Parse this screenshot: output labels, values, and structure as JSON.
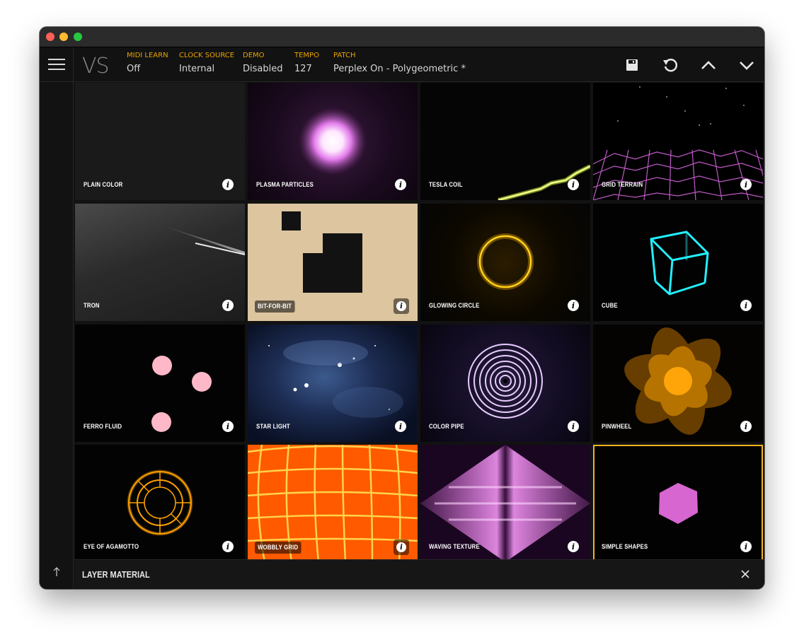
{
  "app": {
    "logo": "VS"
  },
  "header": {
    "fields": [
      {
        "label": "MIDI LEARN",
        "value": "Off"
      },
      {
        "label": "CLOCK SOURCE",
        "value": "Internal"
      },
      {
        "label": "DEMO",
        "value": "Disabled"
      },
      {
        "label": "TEMPO",
        "value": "127"
      },
      {
        "label": "PATCH",
        "value": "Perplex On - Polygeometric *"
      }
    ],
    "actions": [
      "save-icon",
      "undo-icon",
      "chevron-up-icon",
      "chevron-down-icon"
    ]
  },
  "materials": [
    {
      "label": "PLAIN COLOR"
    },
    {
      "label": "PLASMA PARTICLES"
    },
    {
      "label": "TESLA COIL"
    },
    {
      "label": "GRID TERRAIN"
    },
    {
      "label": "TRON"
    },
    {
      "label": "BIT-FOR-BIT"
    },
    {
      "label": "GLOWING CIRCLE"
    },
    {
      "label": "CUBE"
    },
    {
      "label": "FERRO FLUID"
    },
    {
      "label": "STAR LIGHT"
    },
    {
      "label": "COLOR PIPE"
    },
    {
      "label": "PINWHEEL"
    },
    {
      "label": "EYE OF AGAMOTTO"
    },
    {
      "label": "WOBBLY GRID"
    },
    {
      "label": "WAVING TEXTURE"
    },
    {
      "label": "SIMPLE SHAPES",
      "selected": true
    }
  ],
  "footer": {
    "title": "LAYER MATERIAL"
  },
  "colors": {
    "accent": "#f2b320",
    "label": "#e8a400",
    "background": "#121212"
  }
}
